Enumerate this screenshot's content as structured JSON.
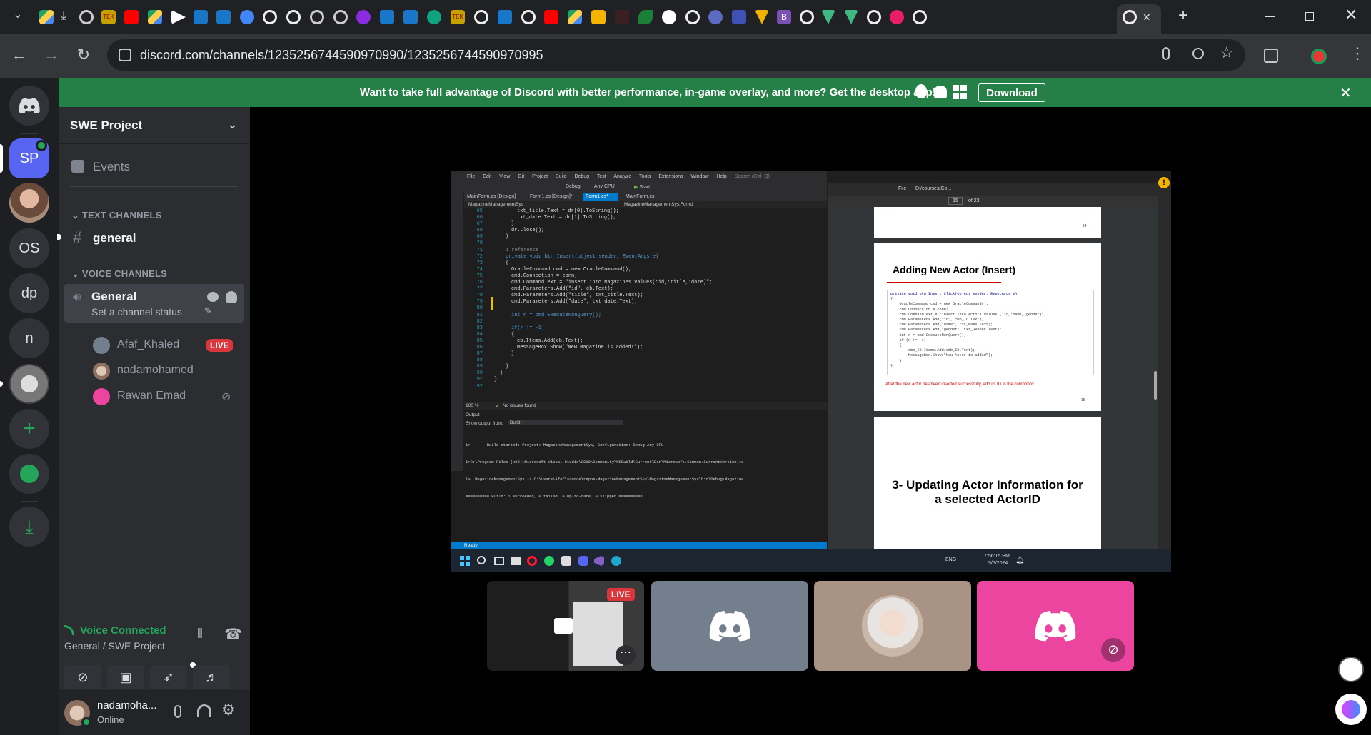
{
  "browser": {
    "url": "discord.com/channels/1235256744590970990/1235256744590970995",
    "new_tab_label": "+",
    "close_tab_label": "✕"
  },
  "banner": {
    "text": "Want to take full advantage of Discord with better performance, in-game overlay, and more? Get the desktop app!",
    "download_label": "Download"
  },
  "guilds": [
    "SP",
    "OS",
    "dp",
    "n"
  ],
  "server": {
    "name": "SWE Project",
    "events_label": "Events",
    "text_category": "TEXT CHANNELS",
    "text_channel": "general",
    "voice_category": "VOICE CHANNELS",
    "voice_channel": "General",
    "channel_status": "Set a channel status",
    "voice_users": [
      {
        "name": "Afaf_Khaled",
        "badge": "LIVE"
      },
      {
        "name": "nadamohamed"
      },
      {
        "name": "Rawan Emad"
      }
    ]
  },
  "voice_connection": {
    "status": "Voice Connected",
    "location": "General / SWE Project"
  },
  "user": {
    "name": "nadamoha...",
    "status": "Online"
  },
  "stream": {
    "live_badge": "LIVE",
    "vs_menu": [
      "File",
      "Edit",
      "View",
      "Git",
      "Project",
      "Build",
      "Debug",
      "Test",
      "Analyze",
      "Tools",
      "Extensions",
      "Window",
      "Help"
    ],
    "vs_search": "Search (Ctrl+Q)",
    "vs_config": "Debug",
    "vs_platform": "Any CPU",
    "vs_start": "Start",
    "vs_tabs": [
      "MainForm.cs [Design]",
      "Form1.cs [Design]*",
      "Form1.cs*",
      "MainForm.cs"
    ],
    "vs_project": "MagazineManagementSys",
    "vs_class": "MagazineManagementSys.Form1",
    "code_lines": [
      "txt_title.Text = dr[0].ToString();",
      "txt_date.Text = dr[1].ToString();",
      "}",
      "dr.Close();",
      "}",
      "",
      "1 reference",
      "private void btn_Insert(object sender, EventArgs e)",
      "{",
      "OracleCommand cmd = new OracleCommand();",
      "cmd.Connection = conn;",
      "cmd.CommandText = \"insert into Magazines values(:id,:title,:date)\";",
      "cmd.Parameters.Add(\"id\", cb.Text);",
      "cmd.Parameters.Add(\"title\", txt_title.Text);",
      "cmd.Parameters.Add(\"date\", txt_date.Text);",
      "",
      "int r = cmd.ExecuteNonQuery();",
      "",
      "if(r != -1)",
      "{",
      "cb.Items.Add(cb.Text);",
      "MessageBox.Show(\"New Magazine is added!\");",
      "}",
      "",
      "}",
      "}",
      "}",
      ""
    ],
    "zoom": "100 %",
    "issues": "No issues found",
    "output_label": "Output",
    "output_from": "Show output from:",
    "output_source": "Build",
    "output_lines": [
      "1>------ Build started: Project: MagazineManagementSys, Configuration: Debug Any CPU ------",
      "1>C:\\Program Files (x86)\\Microsoft Visual Studio\\2019\\Community\\MSBuild\\Current\\Bin\\Microsoft.Common.CurrentVersion.ta",
      "1>  MagazineManagementSys -> C:\\Users\\Afaf\\source\\repos\\MagazineManagementSys\\MagazineManagementSys\\bin\\Debug\\Magazine",
      "========== Build: 1 succeeded, 0 failed, 0 up-to-date, 0 skipped =========="
    ],
    "vs_status": "Ready",
    "pdf_path": "D:/courses/Co...",
    "pdf_file": "File",
    "pdf_page": "15",
    "pdf_pages": "of 23",
    "pdf_page_num_top": "14",
    "pdf_heading": "Adding New Actor (Insert)",
    "pdf_code": [
      "private void btn_Insert_Click(object sender, EventArgs e)",
      "{",
      "    OracleCommand cmd = new OracleCommand();",
      "    cmd.Connection = conn;",
      "    cmd.CommandText = \"insert into Actors values (:id,:name,:gender)\";",
      "    cmd.Parameters.Add(\"id\", cmb_ID.Text);",
      "    cmd.Parameters.Add(\"name\", txt_Name.Text);",
      "    cmd.Parameters.Add(\"gender\", txt_Gender.Text);",
      "    int r = cmd.ExecuteNonQuery();",
      "    if (r != -1)",
      "    {",
      "        cmb_ID.Items.Add(cmb_ID.Text);",
      "        MessageBox.Show(\"New Actor is added\");",
      "    }",
      "}"
    ],
    "pdf_note": "After the new actor has been inserted successfully, add its ID to the combobox",
    "pdf_page_num": "15",
    "pdf_heading2": "3- Updating Actor Information for a selected ActorID",
    "win_lang": "ENG",
    "win_time": "7:56:15 PM",
    "win_date": "5/5/2024"
  },
  "colors": {
    "discord_green": "#248046",
    "blurple": "#5865f2",
    "live_red": "#da373c",
    "pink_tile": "#eb459f",
    "grey_tile": "#747f8d"
  }
}
